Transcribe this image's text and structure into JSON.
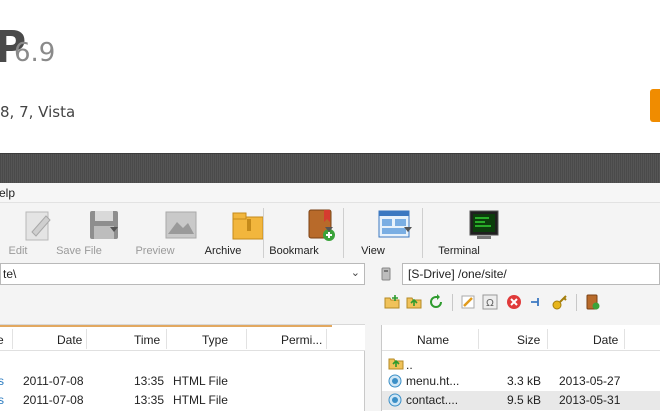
{
  "hero": {
    "title": "P",
    "version": "6.9",
    "os_text": "8, 7, Vista"
  },
  "menu": {
    "help": "elp"
  },
  "toolbar": {
    "edit": "Edit",
    "save_file": "Save File",
    "preview": "Preview",
    "archive": "Archive",
    "bookmark": "Bookmark",
    "view": "View",
    "terminal": "Terminal"
  },
  "left_panel": {
    "path": "te\\",
    "columns": {
      "date": "Date",
      "time": "Time",
      "type": "Type",
      "perms": "Permi..."
    },
    "rows": [
      {
        "date": "2011-07-08",
        "time": "13:35",
        "type": "HTML File"
      },
      {
        "date": "2011-07-08",
        "time": "13:35",
        "type": "HTML File"
      }
    ]
  },
  "right_panel": {
    "path": "[S-Drive]  /one/site/",
    "columns": {
      "name": "Name",
      "size": "Size",
      "date": "Date"
    },
    "rows": [
      {
        "name": "..",
        "size": "",
        "date": ""
      },
      {
        "name": "menu.ht...",
        "size": "3.3 kB",
        "date": "2013-05-27"
      },
      {
        "name": "contact....",
        "size": "9.5 kB",
        "date": "2013-05-31"
      }
    ]
  },
  "colors": {
    "accent": "#f08c00",
    "dark_band": "#4a4a4a",
    "header_underline": "#e2a860"
  }
}
